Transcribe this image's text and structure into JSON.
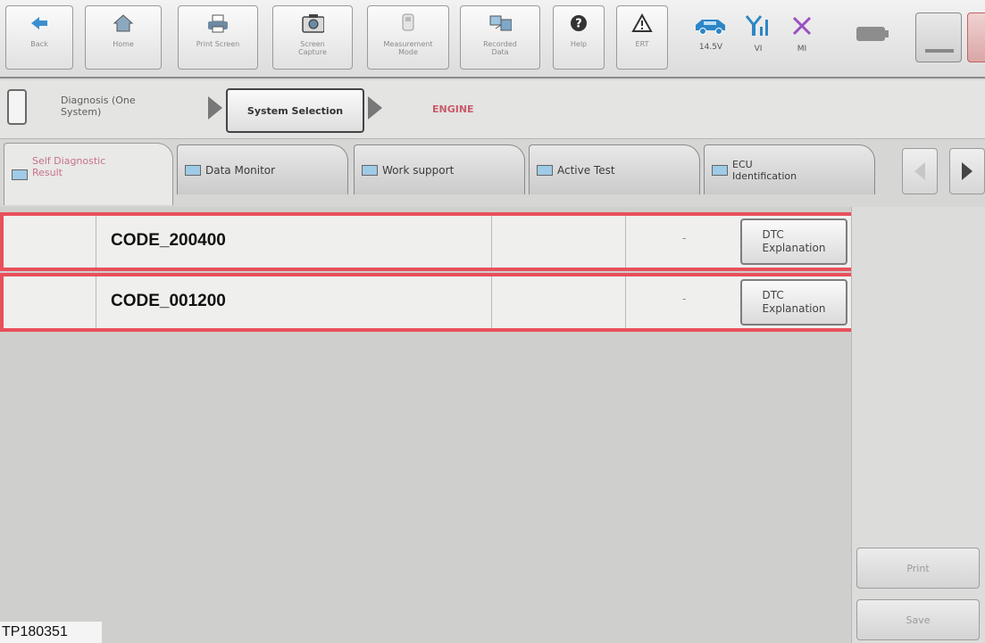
{
  "toolbar": {
    "back": "Back",
    "home": "Home",
    "print_screen": "Print Screen",
    "screen_capture": "Screen\nCapture",
    "measurement_mode": "Measurement\nMode",
    "recorded_data": "Recorded\nData",
    "help": "Help",
    "ert": "ERT",
    "battery_voltage": "14.5V",
    "vi_label": "VI",
    "mi_label": "MI"
  },
  "breadcrumb": {
    "step1": "Diagnosis (One\nSystem)",
    "step2": "System Selection",
    "step3": "ENGINE"
  },
  "tabs": [
    {
      "label": "Self Diagnostic\nResult"
    },
    {
      "label": "Data Monitor"
    },
    {
      "label": "Work support"
    },
    {
      "label": "Active Test"
    },
    {
      "label": "ECU\nIdentification"
    }
  ],
  "results": [
    {
      "code": "CODE_200400",
      "dash": "-",
      "button": "DTC\nExplanation"
    },
    {
      "code": "CODE_001200",
      "dash": "-",
      "button": "DTC\nExplanation"
    }
  ],
  "side": {
    "print": "Print",
    "save": "Save"
  },
  "figure_id": "TP180351",
  "colors": {
    "highlight": "#e8505b",
    "engine_text": "#c85a6a"
  }
}
